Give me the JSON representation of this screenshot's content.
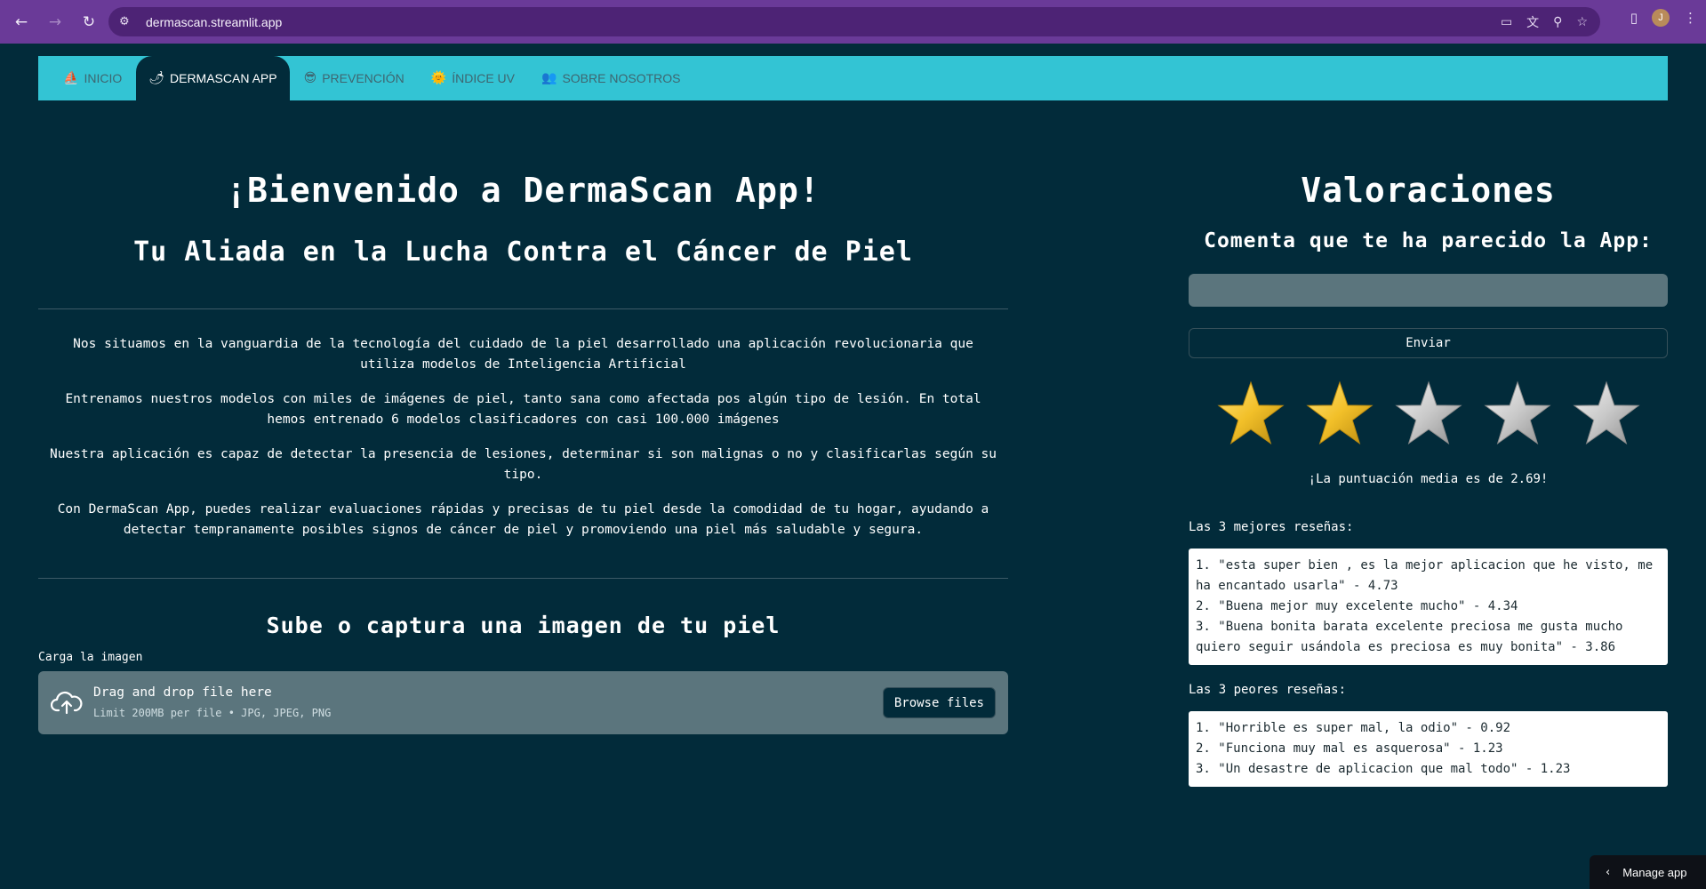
{
  "browser": {
    "url": "dermascan.streamlit.app",
    "avatar_initial": "J"
  },
  "nav": {
    "tabs": [
      {
        "icon": "⛵",
        "label": "INICIO"
      },
      {
        "icon": "🌶",
        "label": "DERMASCAN APP"
      },
      {
        "icon": "😎",
        "label": "PREVENCIÓN"
      },
      {
        "icon": "🌞",
        "label": "ÍNDICE UV"
      },
      {
        "icon": "👥",
        "label": "SOBRE NOSOTROS"
      }
    ],
    "active_tab": "DERMASCAN APP"
  },
  "main": {
    "title": "¡Bienvenido a DermaScan App!",
    "subtitle": "Tu Aliada en la Lucha Contra el Cáncer de Piel",
    "paragraphs": [
      "Nos situamos en la vanguardia de la tecnología del cuidado de la piel desarrollado una aplicación revolucionaria que utiliza modelos de Inteligencia Artificial",
      "Entrenamos nuestros modelos con miles de imágenes de piel, tanto sana como afectada pos algún tipo de lesión. En total hemos entrenado 6 modelos clasificadores con casi 100.000 imágenes",
      "Nuestra aplicación es capaz de detectar la presencia de lesiones, determinar si son malignas o no y clasificarlas según su tipo.",
      "Con DermaScan App, puedes realizar evaluaciones rápidas y precisas de tu piel desde la comodidad de tu hogar, ayudando a detectar tempranamente posibles signos de cáncer de piel y promoviendo una piel más saludable y segura."
    ],
    "upload_title": "Sube o captura una imagen de tu piel",
    "upload_label": "Carga la imagen",
    "dropzone_title": "Drag and drop file here",
    "dropzone_hint": "Limit 200MB per file • JPG, JPEG, PNG",
    "browse_label": "Browse files"
  },
  "ratings": {
    "title": "Valoraciones",
    "prompt": "Comenta que te ha parecido la App:",
    "comment_value": "",
    "send_label": "Enviar",
    "stars_filled": 2,
    "stars_total": 5,
    "average_text": "¡La puntuación media es de 2.69!",
    "best_label": "Las 3 mejores reseñas:",
    "best_reviews": [
      "1. \"esta super bien , es la mejor aplicacion que he visto, me ha encantado usarla\" - 4.73",
      "2. \"Buena mejor muy excelente mucho\" - 4.34",
      "3. \"Buena bonita barata excelente preciosa me gusta mucho quiero seguir usándola es preciosa es muy bonita\" - 3.86"
    ],
    "worst_label": "Las 3 peores reseñas:",
    "worst_reviews": [
      "1. \"Horrible es super mal, la odio\" - 0.92",
      "2. \"Funciona muy mal es asquerosa\" - 1.23",
      "3. \"Un desastre de aplicacion que mal todo\" - 1.23"
    ]
  },
  "manage_app": "Manage app",
  "colors": {
    "background": "#022b3a",
    "nav_bar": "#33c4d4",
    "input_fill": "#5b757d",
    "browser_bar": "#6a3a98",
    "star_gold": "#f2c029",
    "star_silver": "#c9c9c9"
  }
}
